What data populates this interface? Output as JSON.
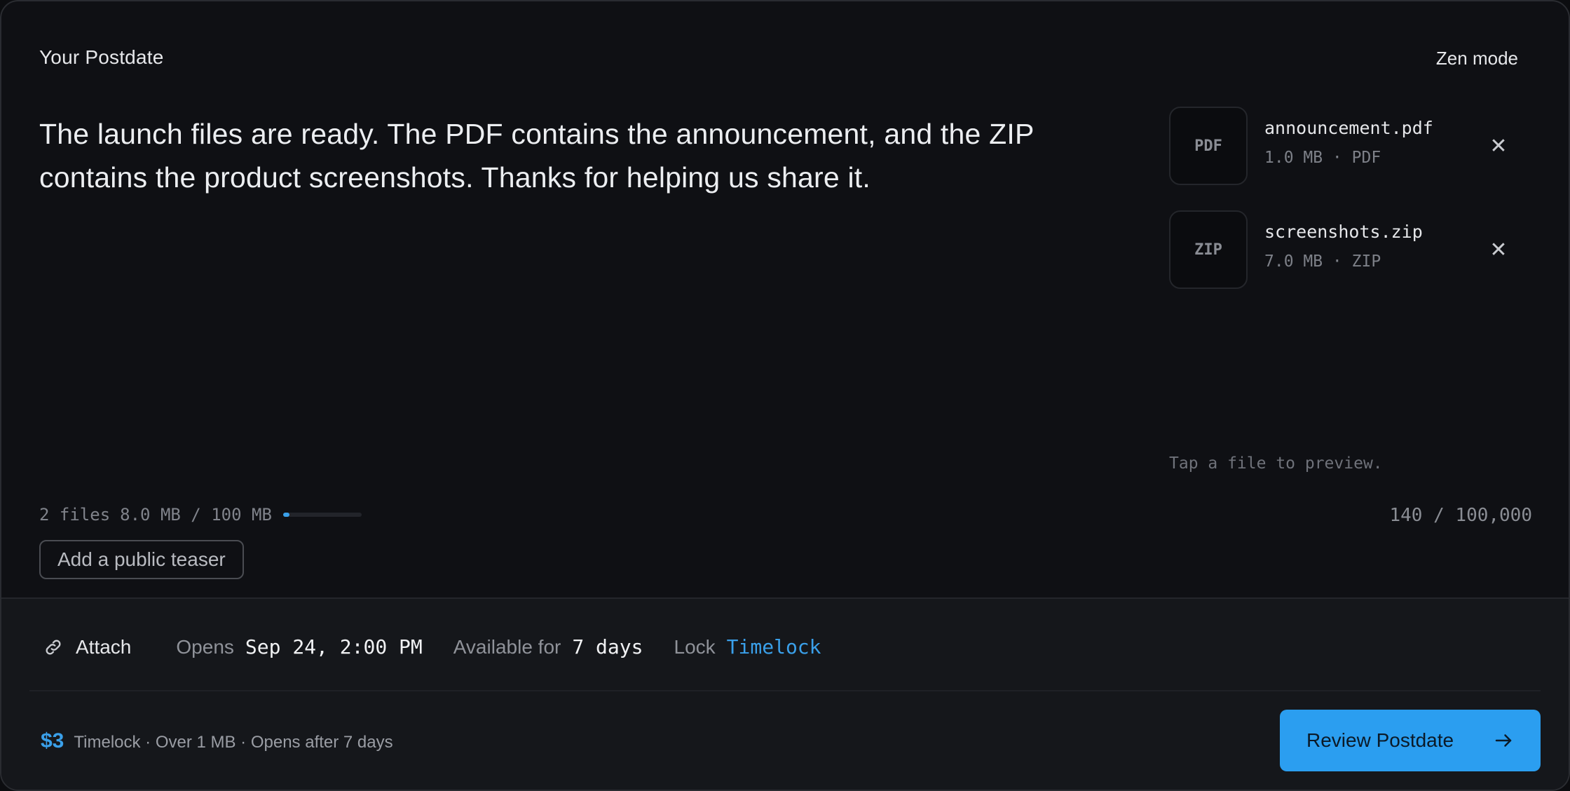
{
  "header": {
    "title": "Your Postdate",
    "zen_mode_label": "Zen mode"
  },
  "message": {
    "text": "The launch files are ready. The PDF contains the announcement, and the ZIP contains the product screenshots. Thanks for helping us share it."
  },
  "files": [
    {
      "thumb_label": "PDF",
      "name": "announcement.pdf",
      "meta": "1.0 MB · PDF",
      "remove_glyph": "✕"
    },
    {
      "thumb_label": "ZIP",
      "name": "screenshots.zip",
      "meta": "7.0 MB · ZIP",
      "remove_glyph": "✕"
    }
  ],
  "preview_hint": "Tap a file to preview.",
  "storage": {
    "file_count": "2 files",
    "usage": "8.0 MB / 100 MB",
    "used_fraction": 0.08
  },
  "char_count": "140 / 100,000",
  "teaser_button": "Add a public teaser",
  "toolbar": {
    "attach_label": "Attach",
    "attach_icon": "paperclip-icon",
    "opens_label": "Opens",
    "opens_value": "Sep 24, 2:00 PM",
    "available_label": "Available for",
    "available_value": "7 days",
    "lock_label": "Lock",
    "lock_value": "Timelock"
  },
  "pricing": {
    "amount": "$3",
    "description": "Timelock · Over 1 MB · Opens after 7 days"
  },
  "review_button": {
    "label": "Review Postdate",
    "arrow_icon": "arrow-right-icon"
  },
  "colors": {
    "accent": "#2b9ef0",
    "background": "#0f1014",
    "footer": "#15171b"
  }
}
